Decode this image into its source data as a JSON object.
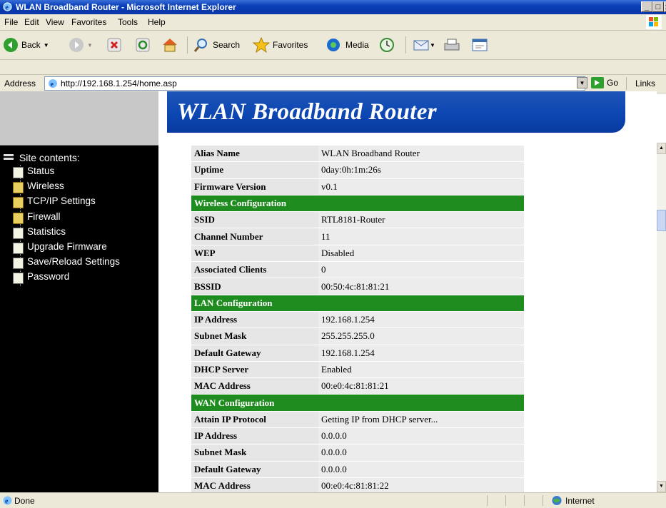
{
  "window": {
    "title": "WLAN Broadband Router - Microsoft Internet Explorer"
  },
  "menu": {
    "items": [
      "File",
      "Edit",
      "View",
      "Favorites",
      "Tools",
      "Help"
    ]
  },
  "toolbar": {
    "back_label": "Back",
    "search_label": "Search",
    "favorites_label": "Favorites",
    "media_label": "Media"
  },
  "address": {
    "label": "Address",
    "url": "http://192.168.1.254/home.asp",
    "go_label": "Go",
    "links_label": "Links"
  },
  "page": {
    "banner_title": "WLAN Broadband Router",
    "site_contents_label": "Site contents:",
    "nav": [
      "Status",
      "Wireless",
      "TCP/IP Settings",
      "Firewall",
      "Statistics",
      "Upgrade Firmware",
      "Save/Reload Settings",
      "Password"
    ]
  },
  "status_table": [
    {
      "label": "Alias Name",
      "value": "WLAN Broadband Router"
    },
    {
      "label": "Uptime",
      "value": "0day:0h:1m:26s"
    },
    {
      "label": "Firmware Version",
      "value": "v0.1"
    },
    {
      "section": "Wireless Configuration"
    },
    {
      "label": "SSID",
      "value": "RTL8181-Router"
    },
    {
      "label": "Channel Number",
      "value": "11"
    },
    {
      "label": "WEP",
      "value": "Disabled"
    },
    {
      "label": "Associated Clients",
      "value": "0"
    },
    {
      "label": "BSSID",
      "value": "00:50:4c:81:81:21"
    },
    {
      "section": "LAN Configuration"
    },
    {
      "label": "IP Address",
      "value": "192.168.1.254"
    },
    {
      "label": "Subnet Mask",
      "value": "255.255.255.0"
    },
    {
      "label": "Default Gateway",
      "value": "192.168.1.254"
    },
    {
      "label": "DHCP Server",
      "value": "Enabled"
    },
    {
      "label": "MAC Address",
      "value": "00:e0:4c:81:81:21"
    },
    {
      "section": "WAN Configuration"
    },
    {
      "label": "Attain IP Protocol",
      "value": "Getting IP from DHCP server..."
    },
    {
      "label": "IP Address",
      "value": "0.0.0.0"
    },
    {
      "label": "Subnet Mask",
      "value": "0.0.0.0"
    },
    {
      "label": "Default Gateway",
      "value": "0.0.0.0"
    },
    {
      "label": "MAC Address",
      "value": "00:e0:4c:81:81:22"
    }
  ],
  "statusbar": {
    "text": "Done",
    "zone": "Internet"
  },
  "colors": {
    "section_green": "#1e8c1e",
    "banner_blue": "#0b45b0"
  }
}
